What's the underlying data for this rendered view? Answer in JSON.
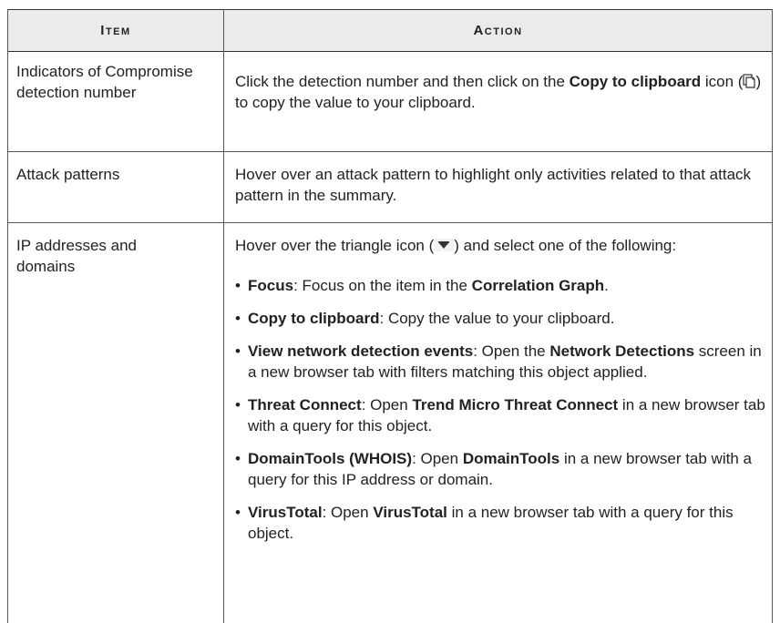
{
  "table": {
    "header_item": "Item",
    "header_action": "Action",
    "rows": [
      {
        "item": "Indicators of Compromise detection number",
        "action": {
          "pre": "Click the detection number and then click on the ",
          "bold": "Copy to clipboard",
          "mid": " icon (",
          "icon": "copy-to-clipboard-icon",
          "post": ") to copy the value to your clipboard."
        }
      },
      {
        "item": "Attack patterns",
        "action": {
          "text": "Hover over an attack pattern to highlight only activities related to that attack pattern in the summary."
        }
      },
      {
        "item": "IP addresses and domains",
        "action": {
          "pre": "Hover over the triangle icon (",
          "icon": "triangle-dropdown-icon",
          "post": ") and select one of the following:",
          "bullets": [
            {
              "b1": "Focus",
              "t1": ": Focus on the item in the ",
              "b2": "Correlation Graph",
              "t2": "."
            },
            {
              "b1": "Copy to clipboard",
              "t1": ": Copy the value to your clipboard.",
              "b2": "",
              "t2": ""
            },
            {
              "b1": "View network detection events",
              "t1": ": Open the ",
              "b2": "Network Detections",
              "t2": " screen in a new browser tab with filters matching this object applied."
            },
            {
              "b1": "Threat Connect",
              "t1": ": Open ",
              "b2": "Trend Micro Threat Connect",
              "t2": " in a new browser tab with a query for this object."
            },
            {
              "b1": "DomainTools (WHOIS)",
              "t1": ": Open ",
              "b2": "DomainTools",
              "t2": " in a new browser tab with a query for this IP address or domain."
            },
            {
              "b1": "VirusTotal",
              "t1": ": Open ",
              "b2": "VirusTotal",
              "t2": " in a new browser tab with a query for this object."
            }
          ]
        }
      }
    ]
  }
}
